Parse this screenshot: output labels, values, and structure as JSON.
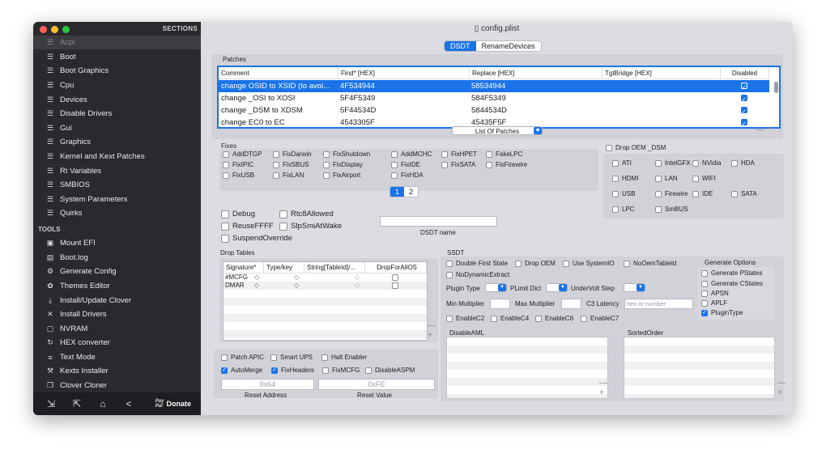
{
  "window": {
    "title": "config.plist"
  },
  "sidebar": {
    "header": "SECTIONS",
    "items": [
      {
        "label": "Acpi",
        "icon": "list-icon",
        "active": true
      },
      {
        "label": "Boot",
        "icon": "list-icon"
      },
      {
        "label": "Boot Graphics",
        "icon": "list-icon"
      },
      {
        "label": "Cpu",
        "icon": "list-icon"
      },
      {
        "label": "Devices",
        "icon": "list-icon"
      },
      {
        "label": "Disable Drivers",
        "icon": "list-icon"
      },
      {
        "label": "Gui",
        "icon": "list-icon"
      },
      {
        "label": "Graphics",
        "icon": "list-icon"
      },
      {
        "label": "Kernel and Kext Patches",
        "icon": "list-icon"
      },
      {
        "label": "Rt Variables",
        "icon": "list-icon"
      },
      {
        "label": "SMBIOS",
        "icon": "list-icon"
      },
      {
        "label": "System Parameters",
        "icon": "list-icon"
      },
      {
        "label": "Quirks",
        "icon": "list-icon"
      }
    ],
    "tools_header": "TOOLS",
    "tools": [
      {
        "label": "Mount EFI",
        "icon": "disk-icon"
      },
      {
        "label": "Boot.log",
        "icon": "log-icon"
      },
      {
        "label": "Generate Config",
        "icon": "gears-icon"
      },
      {
        "label": "Themes Editor",
        "icon": "palette-icon"
      },
      {
        "label": "Install/Update Clover",
        "icon": "download-icon"
      },
      {
        "label": "Install Drivers",
        "icon": "wrench-icon"
      },
      {
        "label": "NVRAM",
        "icon": "chip-icon"
      },
      {
        "label": "HEX converter",
        "icon": "refresh-icon"
      },
      {
        "label": "Text Mode",
        "icon": "text-icon"
      },
      {
        "label": "Kexts Installer",
        "icon": "hammer-icon"
      },
      {
        "label": "Clover Cloner",
        "icon": "copy-icon"
      }
    ],
    "bottom": {
      "donate_label": "Donate",
      "paypal_top": "Pay",
      "paypal_bottom": "Pal"
    }
  },
  "tabs": [
    {
      "label": "DSDT",
      "active": true
    },
    {
      "label": "RenameDevices",
      "active": false
    }
  ],
  "patches": {
    "label": "Patches",
    "columns": [
      "Comment",
      "Find* [HEX]",
      "Replace [HEX]",
      "TgtBridge [HEX]",
      "Disabled"
    ],
    "rows": [
      {
        "comment": "change OSID to XSID (to avoi...",
        "find": "4F534944",
        "replace": "58534944",
        "bridge": "",
        "disabled": true,
        "selected": true
      },
      {
        "comment": "change _OSI to XOSI",
        "find": "5F4F5349",
        "replace": "584F5349",
        "bridge": "",
        "disabled": true
      },
      {
        "comment": "change _DSM to XDSM",
        "find": "5F44534D",
        "replace": "5844534D",
        "bridge": "",
        "disabled": true
      },
      {
        "comment": "change EC0 to EC",
        "find": "4543305F",
        "replace": "45435F5F",
        "bridge": "",
        "disabled": true
      }
    ],
    "list_select": "List Of Patches"
  },
  "fixes": {
    "label": "Fixes",
    "items": [
      "AddDTGP",
      "FixDarwin",
      "FixShutdown",
      "AddMCHC",
      "FixHPET",
      "FakeLPC",
      "FixIPIC",
      "FixSBUS",
      "FixDisplay",
      "FixIDE",
      "FixSATA",
      "FixFirewire",
      "FixUSB",
      "FixLAN",
      "FixAirport",
      "FixHDA"
    ],
    "pages": [
      "1",
      "2"
    ]
  },
  "drop_oem": {
    "label": "Drop OEM _DSM",
    "items": [
      "ATI",
      "IntelGFX",
      "NVidia",
      "HDA",
      "HDMI",
      "LAN",
      "WIFI",
      "USB",
      "Firewire",
      "IDE",
      "SATA",
      "LPC",
      "SmBUS"
    ]
  },
  "options": {
    "debug": "Debug",
    "rtc": "Rtc8Allowed",
    "reuse": "ReuseFFFF",
    "slp": "SlpSmiAtWake",
    "suspend": "SuspendOverride",
    "dsdt_name_label": "DSDT name",
    "dsdt_name_value": ""
  },
  "drop_tables": {
    "label": "Drop Tables",
    "columns": [
      "Signature*",
      "Type/key",
      "String[TableId]/...",
      "DropForAllOS"
    ],
    "rows": [
      {
        "sig": "#MCFG"
      },
      {
        "sig": "DMAR"
      }
    ]
  },
  "bottom_left": {
    "patch_apic": "Patch APIC",
    "smart_ups": "Smart UPS",
    "halt": "Halt Enabler",
    "automerge": "AutoMerge",
    "fixheaders": "FixHeaders",
    "fixmcfg": "FixMCFG",
    "disableaspm": "DisableASPM",
    "reset_address_value": "0x64",
    "reset_value_value": "0xFE",
    "reset_address_label": "Reset Address",
    "reset_value_label": "Reset Value"
  },
  "ssdt": {
    "label": "SSDT",
    "double_first": "Double First State",
    "drop_oem": "Drop OEM",
    "use_sysio": "Use SystemIO",
    "no_oem": "NoOemTableId",
    "no_dyn": "NoDynamicExtract",
    "plugin_type": "Plugin Type",
    "plimit": "PLimit Dict",
    "undervolt": "UnderVolt Step",
    "min_mult": "Min Multiplier",
    "max_mult": "Max Multiplier",
    "c3": "C3 Latency",
    "c3_placeholder": "hex or number",
    "enable_c2": "EnableC2",
    "enable_c4": "EnableC4",
    "enable_c6": "EnableC6",
    "enable_c7": "EnableC7",
    "gen_options": "Generate Options",
    "gen_items": [
      {
        "label": "Generate PStates",
        "checked": false
      },
      {
        "label": "Generate CStates",
        "checked": false
      },
      {
        "label": "APSN",
        "checked": false
      },
      {
        "label": "APLF",
        "checked": false
      },
      {
        "label": "PluginType",
        "checked": true
      }
    ],
    "disable_aml": "DisableAML",
    "sorted_order": "SortedOrder"
  },
  "colors": {
    "accent": "#1a73e8",
    "sidebar": "#2a2a2e"
  }
}
